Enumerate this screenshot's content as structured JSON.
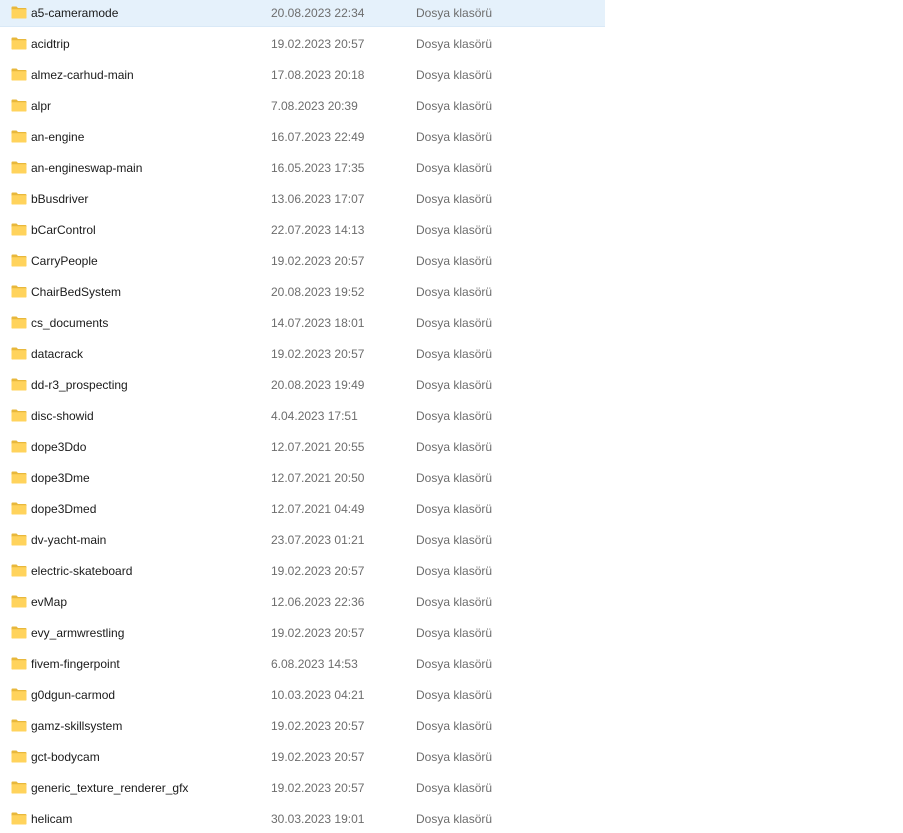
{
  "folder_type_label": "Dosya klasörü",
  "icon": "folder-icon",
  "colors": {
    "selection": "#e5f1fb",
    "folder_back": "#e8b83c",
    "folder_front": "#ffd35c",
    "name_text": "#1a1a1a",
    "meta_text": "#6d6d6d"
  },
  "selected_index": 0,
  "files": [
    {
      "name": "a5-cameramode",
      "date": "20.08.2023 22:34",
      "type": "Dosya klasörü"
    },
    {
      "name": "acidtrip",
      "date": "19.02.2023 20:57",
      "type": "Dosya klasörü"
    },
    {
      "name": "almez-carhud-main",
      "date": "17.08.2023 20:18",
      "type": "Dosya klasörü"
    },
    {
      "name": "alpr",
      "date": "7.08.2023 20:39",
      "type": "Dosya klasörü"
    },
    {
      "name": "an-engine",
      "date": "16.07.2023 22:49",
      "type": "Dosya klasörü"
    },
    {
      "name": "an-engineswap-main",
      "date": "16.05.2023 17:35",
      "type": "Dosya klasörü"
    },
    {
      "name": "bBusdriver",
      "date": "13.06.2023 17:07",
      "type": "Dosya klasörü"
    },
    {
      "name": "bCarControl",
      "date": "22.07.2023 14:13",
      "type": "Dosya klasörü"
    },
    {
      "name": "CarryPeople",
      "date": "19.02.2023 20:57",
      "type": "Dosya klasörü"
    },
    {
      "name": "ChairBedSystem",
      "date": "20.08.2023 19:52",
      "type": "Dosya klasörü"
    },
    {
      "name": "cs_documents",
      "date": "14.07.2023 18:01",
      "type": "Dosya klasörü"
    },
    {
      "name": "datacrack",
      "date": "19.02.2023 20:57",
      "type": "Dosya klasörü"
    },
    {
      "name": "dd-r3_prospecting",
      "date": "20.08.2023 19:49",
      "type": "Dosya klasörü"
    },
    {
      "name": "disc-showid",
      "date": "4.04.2023 17:51",
      "type": "Dosya klasörü"
    },
    {
      "name": "dope3Ddo",
      "date": "12.07.2021 20:55",
      "type": "Dosya klasörü"
    },
    {
      "name": "dope3Dme",
      "date": "12.07.2021 20:50",
      "type": "Dosya klasörü"
    },
    {
      "name": "dope3Dmed",
      "date": "12.07.2021 04:49",
      "type": "Dosya klasörü"
    },
    {
      "name": "dv-yacht-main",
      "date": "23.07.2023 01:21",
      "type": "Dosya klasörü"
    },
    {
      "name": "electric-skateboard",
      "date": "19.02.2023 20:57",
      "type": "Dosya klasörü"
    },
    {
      "name": "evMap",
      "date": "12.06.2023 22:36",
      "type": "Dosya klasörü"
    },
    {
      "name": "evy_armwrestling",
      "date": "19.02.2023 20:57",
      "type": "Dosya klasörü"
    },
    {
      "name": "fivem-fingerpoint",
      "date": "6.08.2023 14:53",
      "type": "Dosya klasörü"
    },
    {
      "name": "g0dgun-carmod",
      "date": "10.03.2023 04:21",
      "type": "Dosya klasörü"
    },
    {
      "name": "gamz-skillsystem",
      "date": "19.02.2023 20:57",
      "type": "Dosya klasörü"
    },
    {
      "name": "gct-bodycam",
      "date": "19.02.2023 20:57",
      "type": "Dosya klasörü"
    },
    {
      "name": "generic_texture_renderer_gfx",
      "date": "19.02.2023 20:57",
      "type": "Dosya klasörü"
    },
    {
      "name": "helicam",
      "date": "30.03.2023 19:01",
      "type": "Dosya klasörü"
    }
  ]
}
